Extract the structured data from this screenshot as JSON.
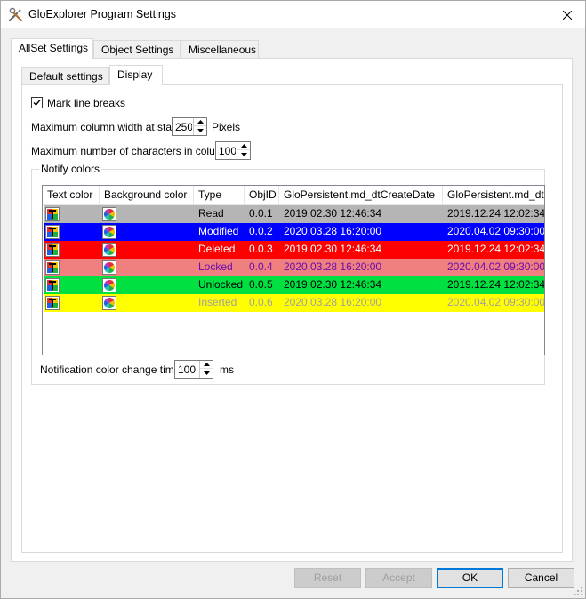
{
  "window": {
    "title": "GloExplorer Program Settings"
  },
  "tabs": [
    {
      "label": "AllSet Settings",
      "active": true
    },
    {
      "label": "Object Settings",
      "active": false
    },
    {
      "label": "Miscellaneous",
      "active": false
    }
  ],
  "subtabs": [
    {
      "label": "Default settings",
      "active": false
    },
    {
      "label": "Display",
      "active": true
    }
  ],
  "display": {
    "mark_line_breaks": {
      "label": "Mark line breaks",
      "checked": true
    },
    "max_col_width": {
      "label": "Maximum column width at start:",
      "value": "250",
      "unit": "Pixels"
    },
    "max_chars": {
      "label": "Maximum number of characters in column:",
      "value": "100"
    },
    "notify_group": "Notify colors",
    "notify_time": {
      "label": "Notification color change time:",
      "value": "100",
      "unit": "ms"
    }
  },
  "table": {
    "columns": [
      "Text color",
      "Background color",
      "Type",
      "ObjID",
      "GloPersistent.md_dtCreateDate",
      "GloPersistent.md_dt"
    ],
    "rows": [
      {
        "type": "Read",
        "objid": "0.0.1",
        "create": "2019.02.30 12:46:34",
        "dt": "2019.12.24 12:02:34",
        "bg": "#b5b5b5",
        "fg": "#000000"
      },
      {
        "type": "Modified",
        "objid": "0.0.2",
        "create": "2020.03.28 16:20:00",
        "dt": "2020.04.02 09:30:00",
        "bg": "#0000ff",
        "fg": "#ffffff"
      },
      {
        "type": "Deleted",
        "objid": "0.0.3",
        "create": "2019.02.30 12:46:34",
        "dt": "2019.12.24 12:02:34",
        "bg": "#ff0000",
        "fg": "#ffffff"
      },
      {
        "type": "Locked",
        "objid": "0.0.4",
        "create": "2020.03.28 16:20:00",
        "dt": "2020.04.02 09:30:00",
        "bg": "#f08080",
        "fg": "#6a0dad"
      },
      {
        "type": "Unlocked",
        "objid": "0.0.5",
        "create": "2019.02.30 12:46:34",
        "dt": "2019.12.24 12:02:34",
        "bg": "#00e040",
        "fg": "#000000"
      },
      {
        "type": "Inserted",
        "objid": "0.0.6",
        "create": "2020.03.28 16:20:00",
        "dt": "2020.04.02 09:30:00",
        "bg": "#ffff00",
        "fg": "#a0a0a0"
      }
    ]
  },
  "buttons": {
    "reset": "Reset",
    "accept": "Accept",
    "ok": "OK",
    "cancel": "Cancel"
  },
  "icons": {
    "app": "tools-icon",
    "close": "close-icon",
    "text_color": "text-color-icon",
    "bg_color": "color-wheel-icon"
  }
}
